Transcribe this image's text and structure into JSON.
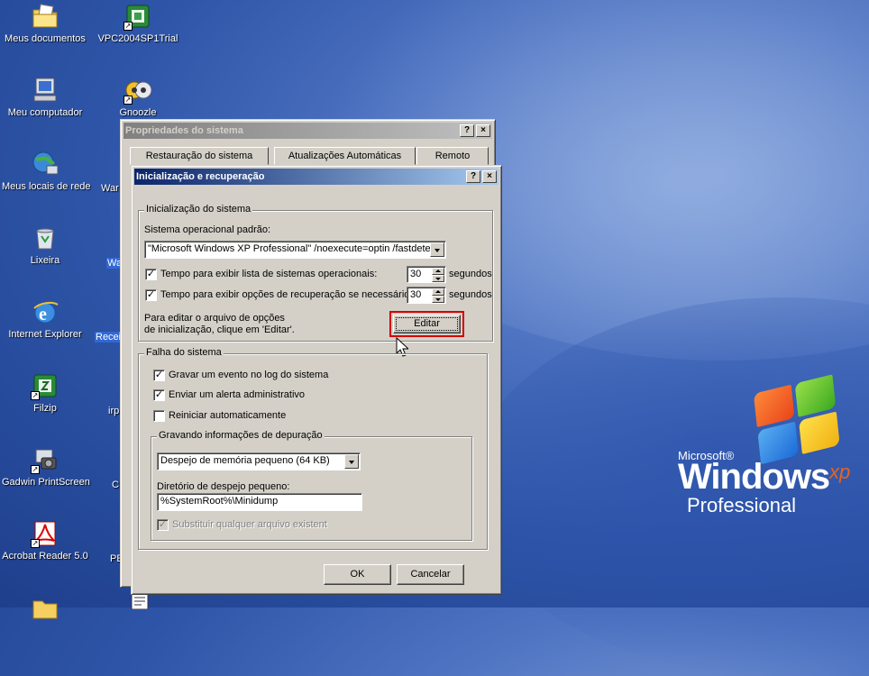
{
  "desktop": {
    "icons": [
      {
        "label": "Meus documentos"
      },
      {
        "label": "VPC2004SP1Trial"
      },
      {
        "label": "Meu computador"
      },
      {
        "label": "Gnoozle"
      },
      {
        "label": "Meus locais de rede"
      },
      {
        "label": "Lixeira"
      },
      {
        "label": "Internet Explorer"
      },
      {
        "label": "Filzip"
      },
      {
        "label": "Gadwin PrintScreen"
      },
      {
        "label": "Acrobat Reader 5.0"
      }
    ],
    "partial_labels": [
      "War",
      "Wa",
      "Recei",
      "irp",
      "C",
      "PE"
    ]
  },
  "logo": {
    "microsoft": "Microsoft®",
    "windows": "Windows",
    "xp": "xp",
    "edition": "Professional"
  },
  "back_window": {
    "title": "Propriedades do sistema",
    "help": "?",
    "close": "×",
    "tabs": [
      "Restauração do sistema",
      "Atualizações Automáticas",
      "Remoto"
    ]
  },
  "dialog": {
    "title": "Inicialização e recuperação",
    "help": "?",
    "close": "×",
    "startup": {
      "group_title": "Inicialização do sistema",
      "default_os_label": "Sistema operacional padrão:",
      "default_os_value": "\"Microsoft Windows XP Professional\" /noexecute=optin /fastdetect",
      "show_list_label": "Tempo para exibir lista de sistemas operacionais:",
      "show_list_value": "30",
      "show_recovery_label": "Tempo para exibir opções de recuperação se necessário:",
      "show_recovery_value": "30",
      "seconds": "segundos",
      "edit_hint_line1": "Para editar o arquivo de opções",
      "edit_hint_line2": "de inicialização, clique em 'Editar'.",
      "edit_button": "Editar"
    },
    "failure": {
      "group_title": "Falha do sistema",
      "log_event": "Gravar um evento no log do sistema",
      "send_alert": "Enviar um alerta administrativo",
      "auto_restart": "Reiniciar automaticamente",
      "debug_group_title": "Gravando informações de depuração",
      "dump_type": "Despejo de memória pequeno (64 KB)",
      "dump_dir_label": "Diretório de despejo pequeno:",
      "dump_dir_value": "%SystemRoot%\\Minidump",
      "overwrite_label": "Substituir qualquer arquivo existent"
    },
    "ok": "OK",
    "cancel": "Cancelar"
  },
  "colors": {
    "highlight": "#d40000"
  }
}
